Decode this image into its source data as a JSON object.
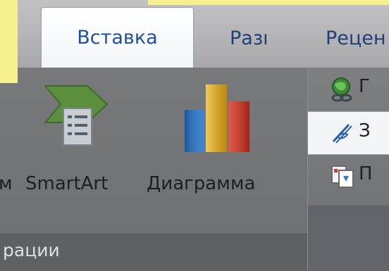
{
  "tabs": {
    "insert": "Вставка",
    "design_partial": "Разı",
    "review_partial": "Рецен"
  },
  "illustrations": {
    "cut_left_label": "м",
    "smartart_label": "SmartArt",
    "chart_label": "Диаграмма",
    "group_label": "рации"
  },
  "links": {
    "hyperlink_partial": "Г",
    "bookmark_partial": "З",
    "crossref_partial": "П"
  },
  "colors": {
    "accent": "#1d4f9c",
    "slide_yellow": "#f6f08e"
  }
}
